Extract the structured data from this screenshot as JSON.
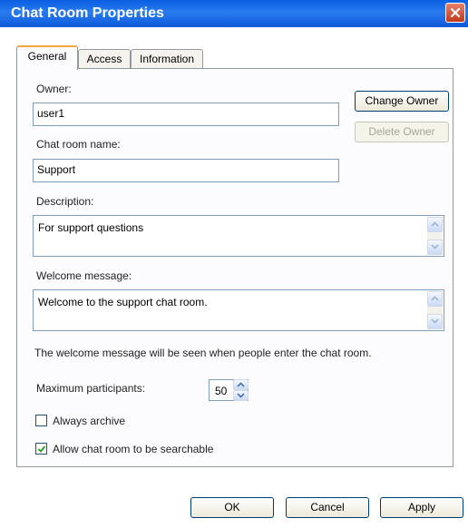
{
  "window": {
    "title": "Chat Room Properties"
  },
  "tabs": [
    "General",
    "Access",
    "Information"
  ],
  "general": {
    "owner_label": "Owner:",
    "owner_value": "user1",
    "change_owner_label": "Change Owner",
    "delete_owner_label": "Delete Owner",
    "room_name_label": "Chat room name:",
    "room_name_value": "Support",
    "description_label": "Description:",
    "description_value": "For support questions",
    "welcome_label": "Welcome message:",
    "welcome_value": "Welcome to the support chat room.",
    "welcome_hint": "The welcome message will be seen when people enter the chat room.",
    "max_participants_label": "Maximum participants:",
    "max_participants_value": "50",
    "always_archive_label": "Always archive",
    "always_archive_checked": false,
    "searchable_label": "Allow chat room to be searchable",
    "searchable_checked": true
  },
  "footer": {
    "ok_label": "OK",
    "cancel_label": "Cancel",
    "apply_label": "Apply"
  },
  "colors": {
    "titlebar": "#0a5fe0",
    "tab_highlight": "#f2a63c",
    "close_button": "#c0391d"
  }
}
